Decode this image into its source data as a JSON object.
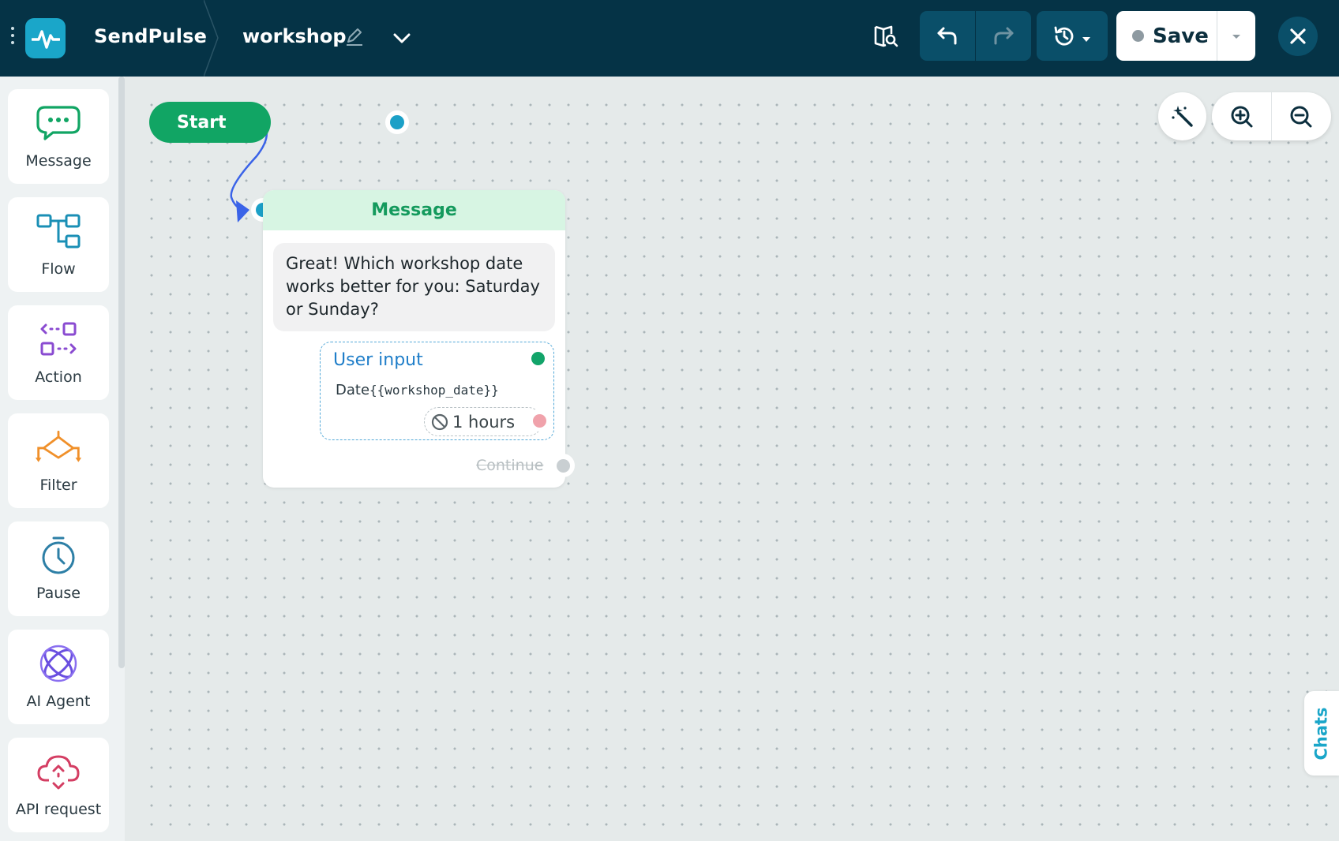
{
  "header": {
    "brand": "SendPulse",
    "flow_name": "workshop",
    "save_label": "Save"
  },
  "sidebar": {
    "items": [
      {
        "label": "Message",
        "icon": "message-bubble-icon",
        "color": "#11a564"
      },
      {
        "label": "Flow",
        "icon": "flow-icon",
        "color": "#1a8fb5"
      },
      {
        "label": "Action",
        "icon": "action-icon",
        "color": "#8a4bd1"
      },
      {
        "label": "Filter",
        "icon": "filter-icon",
        "color": "#f0902a"
      },
      {
        "label": "Pause",
        "icon": "clock-icon",
        "color": "#2d7fa6"
      },
      {
        "label": "AI Agent",
        "icon": "atom-icon",
        "color": "#6a4fe0"
      },
      {
        "label": "API request",
        "icon": "cloud-api-icon",
        "color": "#d43e63"
      }
    ]
  },
  "canvas": {
    "start_label": "Start",
    "message_node": {
      "title": "Message",
      "text": "Great! Which workshop date works better for you: Saturday or Sunday?",
      "user_input": {
        "title": "User input",
        "var_label": "Date",
        "var_value": "{{workshop_date}}",
        "timeout": "1 hours"
      },
      "continue_label": "Continue"
    }
  },
  "chats_tab": "Chats",
  "colors": {
    "topbar": "#053346",
    "accent": "#1aa6c9",
    "green": "#11a564",
    "wire": "#3a63e8"
  }
}
